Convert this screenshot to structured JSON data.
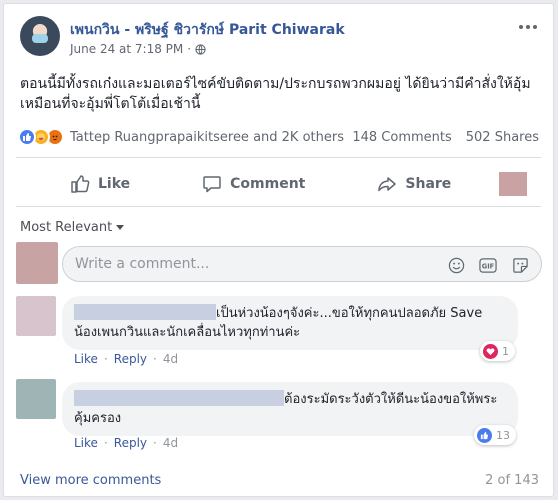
{
  "post": {
    "author": "เพนกวิน - พริษฐ์ ชิวารักษ์ Parit Chiwarak",
    "timestamp": "June 24 at 7:18 PM",
    "separator": "·",
    "text": "ตอนนี้มีทั้งรถเก๋งและมอเตอร์ไซค์ขับติดตาม/ประกบรถพวกผมอยู่ ได้ยินว่ามีคำสั่งให้อุ้มเหมือนที่จะอุ้มพี่โตโต้เมื่อเช้านี้"
  },
  "reactions": {
    "icons": [
      "like-icon",
      "care-icon",
      "angry-icon"
    ],
    "reactors": "Tattep Ruangprapaikitseree and 2K others",
    "comments_count": "148 Comments",
    "shares_count": "502 Shares"
  },
  "actions": {
    "like": "Like",
    "comment": "Comment",
    "share": "Share"
  },
  "comments_section": {
    "sort": "Most Relevant",
    "composer_placeholder": "Write a comment...",
    "comments": [
      {
        "text_line1": "เป็นห่วงน้องๆจังค่ะ...ขอให้ทุกคนปลอดภัย Save",
        "text_line2": "น้องเพนกวินและนักเคลื่อนไหวทุกท่านค่ะ",
        "like_label": "Like",
        "reply_label": "Reply",
        "age": "4d",
        "reaction_icon": "love-icon",
        "reaction_count": "1"
      },
      {
        "text_line1": "ต้องระมัดระวังตัวให้ดีนะน้องขอให้พระ",
        "text_line2": "คุ้มครอง",
        "like_label": "Like",
        "reply_label": "Reply",
        "age": "4d",
        "reaction_icon": "like-icon",
        "reaction_count": "13"
      }
    ],
    "view_more": "View more comments",
    "pagination": "2 of 143"
  },
  "colors": {
    "link": "#365899",
    "muted": "#616770",
    "like_blue": "#4a7ced",
    "love_red": "#e0245e"
  }
}
